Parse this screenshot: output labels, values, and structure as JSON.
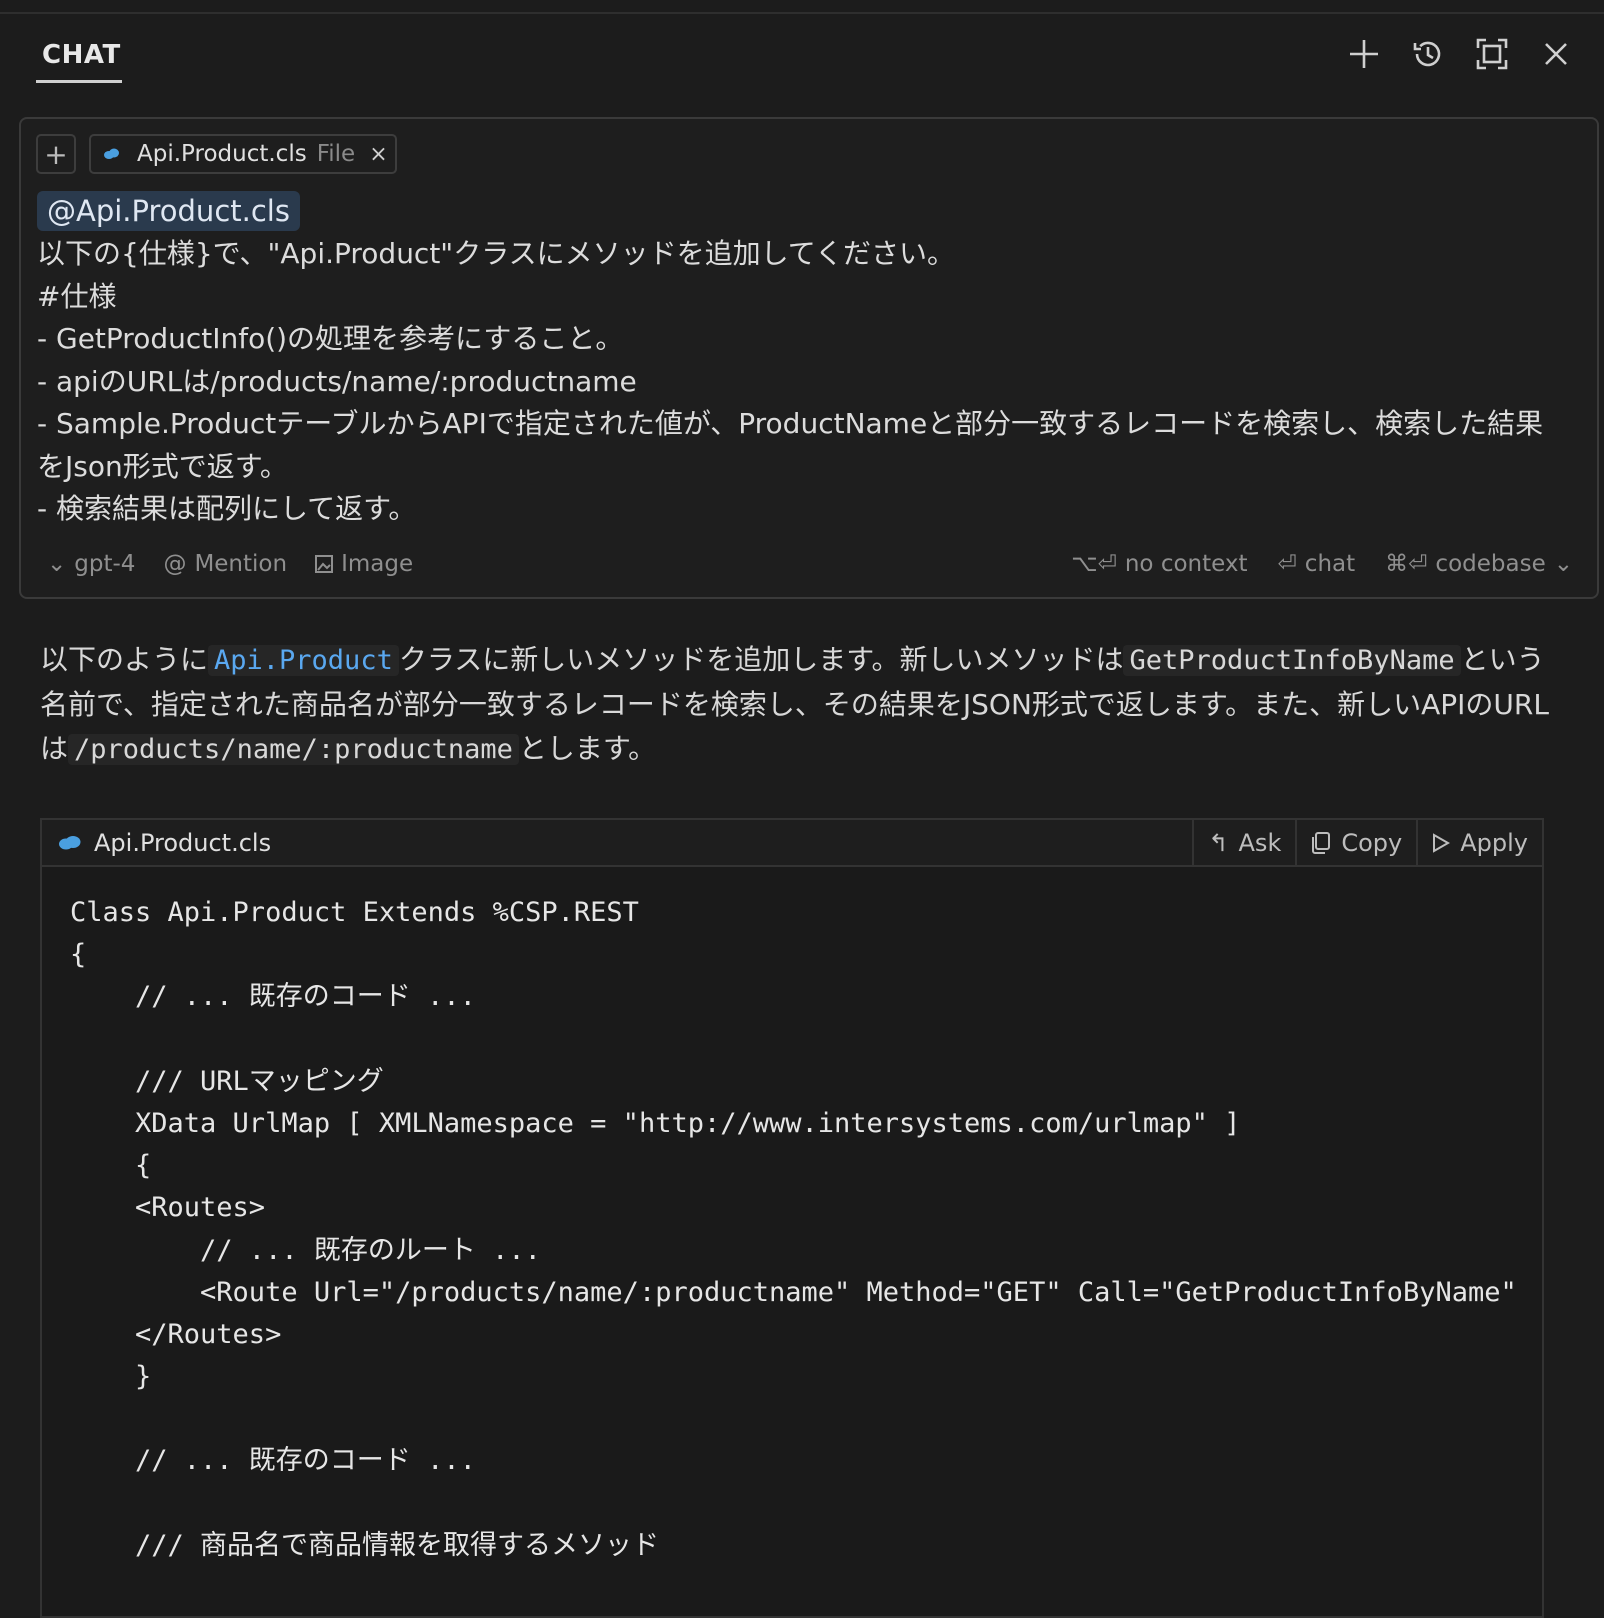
{
  "header": {
    "tab_label": "CHAT",
    "icons": [
      "plus-icon",
      "history-icon",
      "maximize-icon",
      "close-icon"
    ]
  },
  "input": {
    "file_chip": {
      "name": "Api.Product.cls",
      "kind": "File"
    },
    "mention": "@Api.Product.cls",
    "prompt_lines": [
      "以下の{仕様}で、\"Api.Product\"クラスにメソッドを追加してください。",
      "#仕様",
      "- GetProductInfo()の処理を参考にすること。",
      "- apiのURLは/products/name/:productname",
      "- Sample.ProductテーブルからAPIで指定された値が、ProductNameと部分一致するレコードを検索し、検索した結果をJson形式で返す。",
      "- 検索結果は配列にして返す。"
    ],
    "footer": {
      "model": "gpt-4",
      "mention": "Mention",
      "image": "Image",
      "no_context_key": "⌥⏎",
      "no_context": "no context",
      "chat_key": "⏎",
      "chat": "chat",
      "codebase_key": "⌘⏎",
      "codebase": "codebase"
    }
  },
  "reply": {
    "p1_a": "以下のように",
    "p1_code1": "Api.Product",
    "p1_b": "クラスに新しいメソッドを追加します。新しいメソッドは",
    "p1_code2": "GetProductInfoByName",
    "p1_c": "という名前で、指定された商品名が部分一致するレコードを検索し、その結果をJSON形式で返します。また、新しいAPIのURLは",
    "p1_code3": "/products/name/:productname",
    "p1_d": "とします。"
  },
  "code": {
    "filename": "Api.Product.cls",
    "actions": {
      "ask": "Ask",
      "copy": "Copy",
      "apply": "Apply"
    },
    "lines": [
      "Class Api.Product Extends %CSP.REST",
      "{",
      "    // ... 既存のコード ...",
      "",
      "    /// URLマッピング",
      "    XData UrlMap [ XMLNamespace = \"http://www.intersystems.com/urlmap\" ]",
      "    {",
      "    <Routes>",
      "        // ... 既存のルート ...",
      "        <Route Url=\"/products/name/:productname\" Method=\"GET\" Call=\"GetProductInfoByName\" />",
      "    </Routes>",
      "    }",
      "",
      "    // ... 既存のコード ...",
      "",
      "    /// 商品名で商品情報を取得するメソッド"
    ]
  },
  "colors": {
    "background": "#1c1c1c",
    "accent_code": "#5aa8f0",
    "mention_bg": "#2a3a4d",
    "salesforce_cloud": "#4a9fe0"
  }
}
